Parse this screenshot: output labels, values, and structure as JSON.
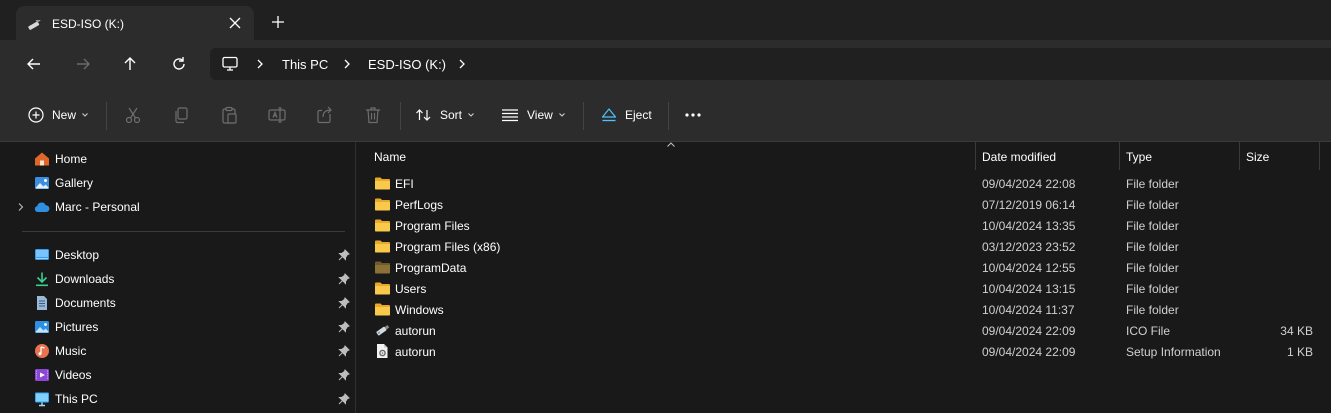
{
  "tab": {
    "title": "ESD-ISO (K:)",
    "icon": "usb-drive-icon"
  },
  "address": {
    "root_icon": "computer-icon",
    "crumbs": [
      "This PC",
      "ESD-ISO (K:)"
    ]
  },
  "toolbar": {
    "new_label": "New",
    "sort_label": "Sort",
    "view_label": "View",
    "eject_label": "Eject"
  },
  "nav": {
    "top": [
      {
        "label": "Home",
        "icon": "home-icon"
      },
      {
        "label": "Gallery",
        "icon": "gallery-icon"
      },
      {
        "label": "Marc - Personal",
        "icon": "onedrive-icon"
      }
    ],
    "pinned": [
      {
        "label": "Desktop",
        "icon": "desktop-icon"
      },
      {
        "label": "Downloads",
        "icon": "downloads-icon"
      },
      {
        "label": "Documents",
        "icon": "documents-icon"
      },
      {
        "label": "Pictures",
        "icon": "pictures-icon"
      },
      {
        "label": "Music",
        "icon": "music-icon"
      },
      {
        "label": "Videos",
        "icon": "videos-icon"
      },
      {
        "label": "This PC",
        "icon": "this-pc-icon"
      }
    ]
  },
  "files": {
    "columns": {
      "name": "Name",
      "date": "Date modified",
      "type": "Type",
      "size": "Size"
    },
    "rows": [
      {
        "name": "EFI",
        "date": "09/04/2024 22:08",
        "type": "File folder",
        "size": "",
        "icon": "folder-icon"
      },
      {
        "name": "PerfLogs",
        "date": "07/12/2019 06:14",
        "type": "File folder",
        "size": "",
        "icon": "folder-icon"
      },
      {
        "name": "Program Files",
        "date": "10/04/2024 13:35",
        "type": "File folder",
        "size": "",
        "icon": "folder-icon"
      },
      {
        "name": "Program Files (x86)",
        "date": "03/12/2023 23:52",
        "type": "File folder",
        "size": "",
        "icon": "folder-icon"
      },
      {
        "name": "ProgramData",
        "date": "10/04/2024 12:55",
        "type": "File folder",
        "size": "",
        "icon": "hidden-folder-icon"
      },
      {
        "name": "Users",
        "date": "10/04/2024 13:15",
        "type": "File folder",
        "size": "",
        "icon": "folder-icon"
      },
      {
        "name": "Windows",
        "date": "10/04/2024 11:37",
        "type": "File folder",
        "size": "",
        "icon": "folder-icon"
      },
      {
        "name": "autorun",
        "date": "09/04/2024 22:09",
        "type": "ICO File",
        "size": "34 KB",
        "icon": "usb-drive-icon"
      },
      {
        "name": "autorun",
        "date": "09/04/2024 22:09",
        "type": "Setup Information",
        "size": "1 KB",
        "icon": "setup-file-icon"
      }
    ]
  },
  "colors": {
    "background": "#191919",
    "chrome": "#2c2c2c",
    "folder": "#f4c144",
    "accent": "#4cc2ff"
  }
}
